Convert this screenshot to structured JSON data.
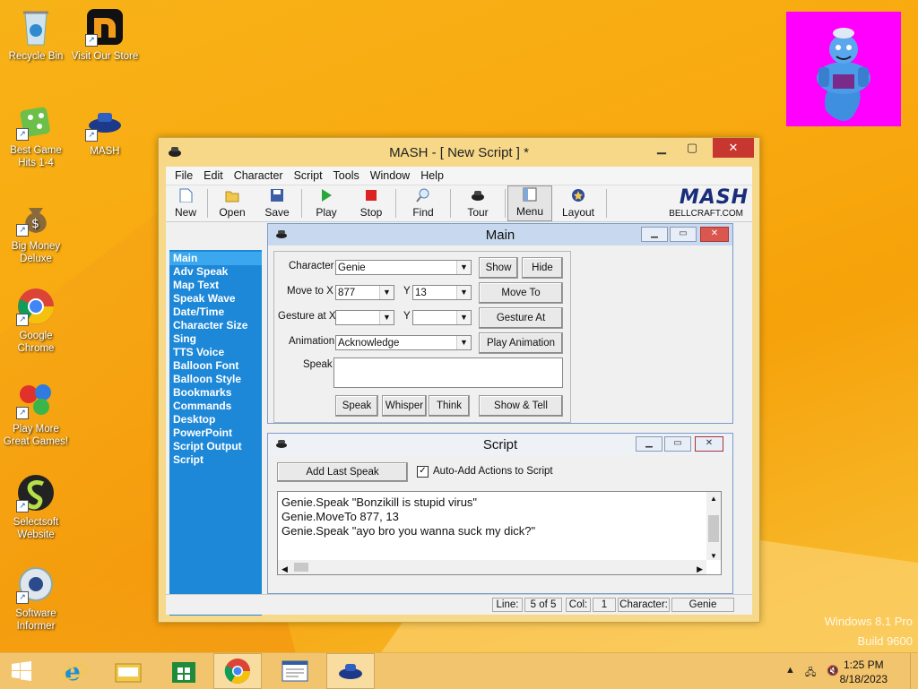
{
  "desktop": {
    "icons": [
      {
        "label": "Recycle Bin"
      },
      {
        "label": "Visit Our Store"
      },
      {
        "label": "Best Game Hits 1-4"
      },
      {
        "label": "MASH"
      },
      {
        "label": "Big Money Deluxe"
      },
      {
        "label": "Google Chrome"
      },
      {
        "label": "Play More Great Games!"
      },
      {
        "label": "Selectsoft Website"
      },
      {
        "label": "Software Informer"
      }
    ],
    "watermark_line1": "Windows 8.1 Pro",
    "watermark_line2": "Build 9600"
  },
  "window": {
    "title": "MASH - [ New Script ] *",
    "minimize": "▁",
    "maximize": "▢",
    "close": "✕",
    "menu": [
      "File",
      "Edit",
      "Character",
      "Script",
      "Tools",
      "Window",
      "Help"
    ],
    "toolbar": [
      "New",
      "Open",
      "Save",
      "Play",
      "Stop",
      "Find",
      "Tour",
      "Menu",
      "Layout"
    ],
    "logo": "MASH",
    "logo_sub": "BELLCRAFT.COM"
  },
  "leftnav": [
    "Main",
    "Adv Speak",
    "Map Text",
    "Speak Wave",
    "Date/Time",
    "Character Size",
    "Sing",
    "TTS Voice",
    "Balloon Font",
    "Balloon Style",
    "Bookmarks",
    "Commands",
    "Desktop",
    "PowerPoint",
    "Script Output",
    "Script"
  ],
  "main_panel": {
    "title": "Main",
    "character_label": "Character",
    "character_value": "Genie",
    "show": "Show",
    "hide": "Hide",
    "moveto_label": "Move to X",
    "move_x": "877",
    "y_label": "Y",
    "move_y": "13",
    "move_to_btn": "Move To",
    "gesture_label": "Gesture at X",
    "gesture_x": "",
    "gesture_y": "",
    "gesture_btn": "Gesture At",
    "animation_label": "Animation",
    "animation_value": "Acknowledge",
    "play_anim": "Play Animation",
    "speak_label": "Speak",
    "speak_value": "",
    "speak_btn": "Speak",
    "whisper_btn": "Whisper",
    "think_btn": "Think",
    "show_tell_btn": "Show & Tell"
  },
  "script_panel": {
    "title": "Script",
    "add_last": "Add Last Speak",
    "auto_add": "Auto-Add Actions to Script",
    "lines": [
      "Genie.Speak \"Bonzikill is stupid virus\"",
      "Genie.MoveTo 877, 13",
      "Genie.Speak \"ayo bro you wanna suck my dick?\""
    ]
  },
  "status": {
    "line_label": "Line:",
    "line_value": "5 of 5",
    "col_label": "Col:",
    "col_value": "1",
    "char_label": "Character:",
    "char_value": "Genie"
  },
  "taskbar": {
    "time": "1:25 PM",
    "date": "8/18/2023"
  }
}
